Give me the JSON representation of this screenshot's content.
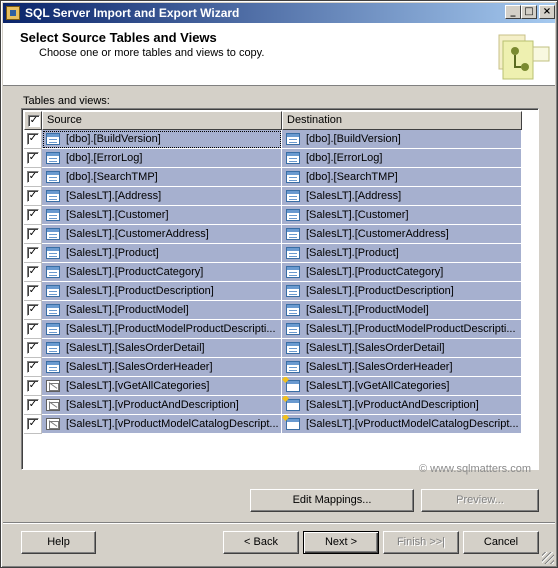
{
  "window": {
    "title": "SQL Server Import and Export Wizard",
    "controls": {
      "minimize": "_",
      "maximize": "□",
      "close": "×"
    }
  },
  "header": {
    "title": "Select Source Tables and Views",
    "subtitle": "Choose one or more tables and views to copy."
  },
  "grid": {
    "label": "Tables and views:",
    "columns": {
      "check": "✓",
      "source": "Source",
      "destination": "Destination"
    },
    "rows": [
      {
        "checked": true,
        "src": "[dbo].[BuildVersion]",
        "dst": "[dbo].[BuildVersion]",
        "src_icon": "table-icon",
        "dst_icon": "table-icon"
      },
      {
        "checked": true,
        "src": "[dbo].[ErrorLog]",
        "dst": "[dbo].[ErrorLog]",
        "src_icon": "table-icon",
        "dst_icon": "table-icon"
      },
      {
        "checked": true,
        "src": "[dbo].[SearchTMP]",
        "dst": "[dbo].[SearchTMP]",
        "src_icon": "table-icon",
        "dst_icon": "table-icon"
      },
      {
        "checked": true,
        "src": "[SalesLT].[Address]",
        "dst": "[SalesLT].[Address]",
        "src_icon": "table-icon",
        "dst_icon": "table-icon"
      },
      {
        "checked": true,
        "src": "[SalesLT].[Customer]",
        "dst": "[SalesLT].[Customer]",
        "src_icon": "table-icon",
        "dst_icon": "table-icon"
      },
      {
        "checked": true,
        "src": "[SalesLT].[CustomerAddress]",
        "dst": "[SalesLT].[CustomerAddress]",
        "src_icon": "table-icon",
        "dst_icon": "table-icon"
      },
      {
        "checked": true,
        "src": "[SalesLT].[Product]",
        "dst": "[SalesLT].[Product]",
        "src_icon": "table-icon",
        "dst_icon": "table-icon"
      },
      {
        "checked": true,
        "src": "[SalesLT].[ProductCategory]",
        "dst": "[SalesLT].[ProductCategory]",
        "src_icon": "table-icon",
        "dst_icon": "table-icon"
      },
      {
        "checked": true,
        "src": "[SalesLT].[ProductDescription]",
        "dst": "[SalesLT].[ProductDescription]",
        "src_icon": "table-icon",
        "dst_icon": "table-icon"
      },
      {
        "checked": true,
        "src": "[SalesLT].[ProductModel]",
        "dst": "[SalesLT].[ProductModel]",
        "src_icon": "table-icon",
        "dst_icon": "table-icon"
      },
      {
        "checked": true,
        "src": "[SalesLT].[ProductModelProductDescripti...",
        "dst": "[SalesLT].[ProductModelProductDescripti...",
        "src_icon": "table-icon",
        "dst_icon": "table-icon"
      },
      {
        "checked": true,
        "src": "[SalesLT].[SalesOrderDetail]",
        "dst": "[SalesLT].[SalesOrderDetail]",
        "src_icon": "table-icon",
        "dst_icon": "table-icon"
      },
      {
        "checked": true,
        "src": "[SalesLT].[SalesOrderHeader]",
        "dst": "[SalesLT].[SalesOrderHeader]",
        "src_icon": "table-icon",
        "dst_icon": "table-icon"
      },
      {
        "checked": true,
        "src": "[SalesLT].[vGetAllCategories]",
        "dst": "[SalesLT].[vGetAllCategories]",
        "src_icon": "view-icon",
        "dst_icon": "new-table-icon"
      },
      {
        "checked": true,
        "src": "[SalesLT].[vProductAndDescription]",
        "dst": "[SalesLT].[vProductAndDescription]",
        "src_icon": "view-icon",
        "dst_icon": "new-table-icon"
      },
      {
        "checked": true,
        "src": "[SalesLT].[vProductModelCatalogDescript...",
        "dst": "[SalesLT].[vProductModelCatalogDescript...",
        "src_icon": "view-icon",
        "dst_icon": "new-table-icon"
      }
    ]
  },
  "buttons": {
    "edit_mappings": "Edit Mappings...",
    "preview": "Preview...",
    "help": "Help",
    "back": "< Back",
    "next": "Next >",
    "finish": "Finish >>|",
    "cancel": "Cancel"
  },
  "watermark": "© www.sqlmatters.com",
  "colors": {
    "titlebar_start": "#0a246a",
    "titlebar_end": "#a6caf0",
    "selected_row": "#a6b0cf",
    "dialog_face": "#d4d0c8"
  }
}
